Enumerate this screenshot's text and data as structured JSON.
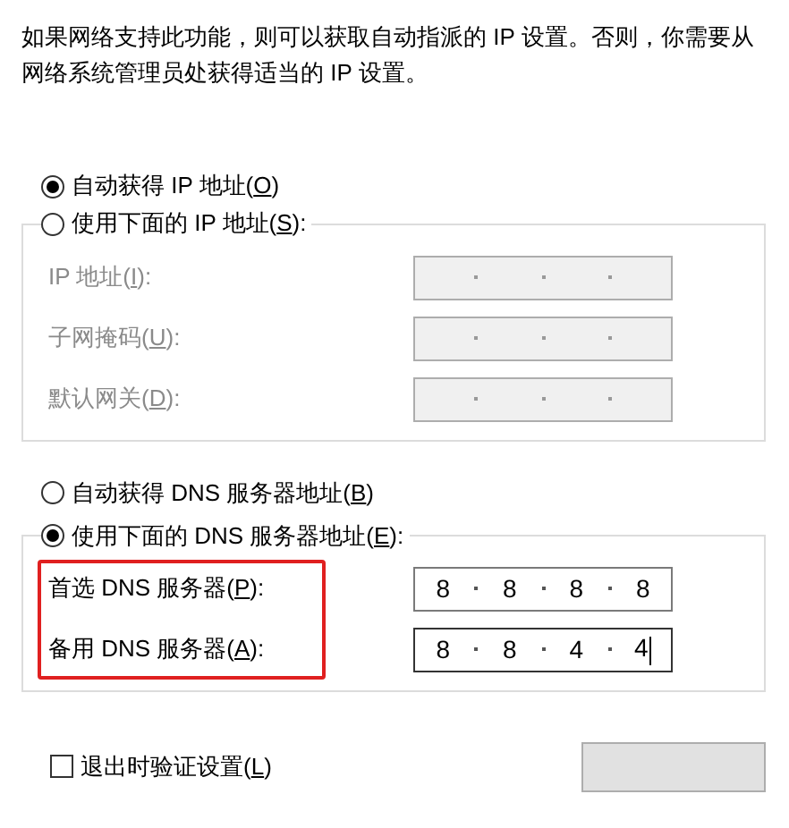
{
  "description": "如果网络支持此功能，则可以获取自动指派的 IP 设置。否则，你需要从网络系统管理员处获得适当的 IP 设置。",
  "ip_section": {
    "options": [
      {
        "text_before": "自动获得 IP 地址(",
        "access_key": "O",
        "text_after": ")",
        "selected": true
      },
      {
        "text_before": "使用下面的 IP 地址(",
        "access_key": "S",
        "text_after": "):",
        "selected": false
      }
    ],
    "disabled": true,
    "rows": [
      {
        "text_before": "IP 地址(",
        "access_key": "I",
        "text_after": "):"
      },
      {
        "text_before": "子网掩码(",
        "access_key": "U",
        "text_after": "):"
      },
      {
        "text_before": "默认网关(",
        "access_key": "D",
        "text_after": "):"
      }
    ]
  },
  "dns_section": {
    "options": [
      {
        "text_before": "自动获得 DNS 服务器地址(",
        "access_key": "B",
        "text_after": ")",
        "selected": false
      },
      {
        "text_before": "使用下面的 DNS 服务器地址(",
        "access_key": "E",
        "text_after": "):",
        "selected": true
      }
    ],
    "disabled": false,
    "highlighted": true,
    "rows": [
      {
        "text_before": "首选 DNS 服务器(",
        "access_key": "P",
        "text_after": "):",
        "octets": [
          "8",
          "8",
          "8",
          "8"
        ],
        "focused": false
      },
      {
        "text_before": "备用 DNS 服务器(",
        "access_key": "A",
        "text_after": "):",
        "octets": [
          "8",
          "8",
          "4",
          "4"
        ],
        "focused": true
      }
    ]
  },
  "validate_on_exit": {
    "text_before": "退出时验证设置(",
    "access_key": "L",
    "text_after": ")",
    "checked": false
  }
}
